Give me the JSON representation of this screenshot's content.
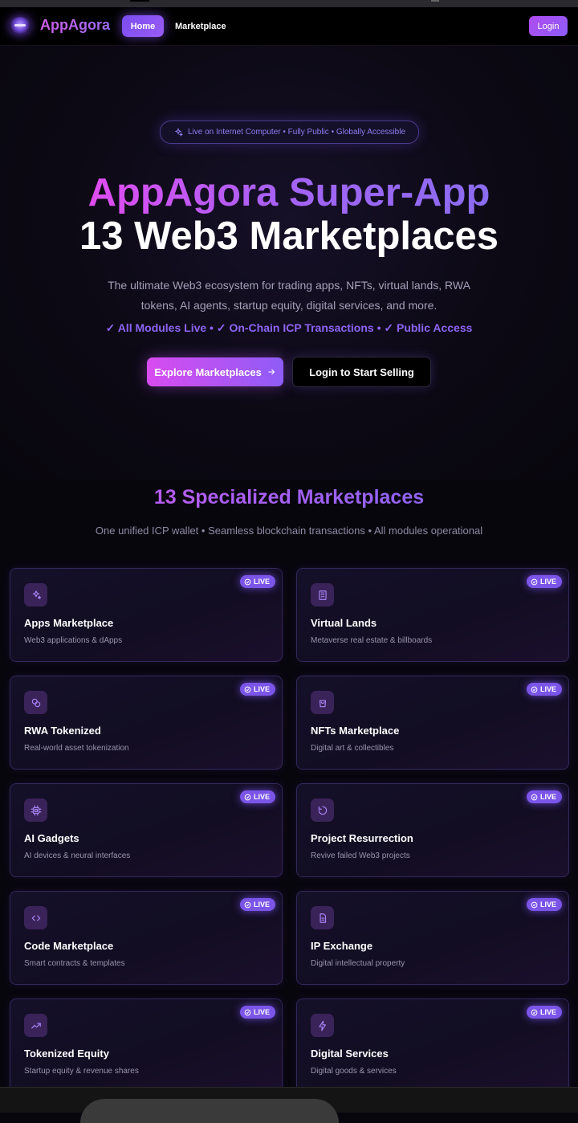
{
  "nav": {
    "brand": "AppAgora",
    "home_label": "Home",
    "marketplace_label": "Marketplace",
    "login_label": "Login"
  },
  "hero": {
    "pill_text": "Live on Internet Computer • Fully Public • Globally Accessible",
    "title_line1": "AppAgora Super-App",
    "title_line2": "13 Web3 Marketplaces",
    "description": "The ultimate Web3 ecosystem for trading apps, NFTs, virtual lands, RWA tokens, AI agents, startup equity, digital services, and more.",
    "checks": "✓ All Modules Live • ✓ On-Chain ICP Transactions • ✓ Public Access",
    "explore_label": "Explore Marketplaces",
    "login_sell_label": "Login to Start Selling"
  },
  "section": {
    "title": "13 Specialized Marketplaces",
    "subtitle": "One unified ICP wallet • Seamless blockchain transactions • All modules operational"
  },
  "badge_label": "LIVE",
  "cards": [
    {
      "title": "Apps Marketplace",
      "subtitle": "Web3 applications & dApps",
      "icon": "sparkles-icon"
    },
    {
      "title": "Virtual Lands",
      "subtitle": "Metaverse real estate & billboards",
      "icon": "building-icon"
    },
    {
      "title": "RWA Tokenized",
      "subtitle": "Real-world asset tokenization",
      "icon": "coins-icon"
    },
    {
      "title": "NFTs Marketplace",
      "subtitle": "Digital art & collectibles",
      "icon": "shopping-bag-icon"
    },
    {
      "title": "AI Gadgets",
      "subtitle": "AI devices & neural interfaces",
      "icon": "cpu-icon"
    },
    {
      "title": "Project Resurrection",
      "subtitle": "Revive failed Web3 projects",
      "icon": "rotate-icon"
    },
    {
      "title": "Code Marketplace",
      "subtitle": "Smart contracts & templates",
      "icon": "code-icon"
    },
    {
      "title": "IP Exchange",
      "subtitle": "Digital intellectual property",
      "icon": "document-icon"
    },
    {
      "title": "Tokenized Equity",
      "subtitle": "Startup equity & revenue shares",
      "icon": "trending-up-icon"
    },
    {
      "title": "Digital Services",
      "subtitle": "Digital goods & services",
      "icon": "lightning-icon"
    }
  ]
}
